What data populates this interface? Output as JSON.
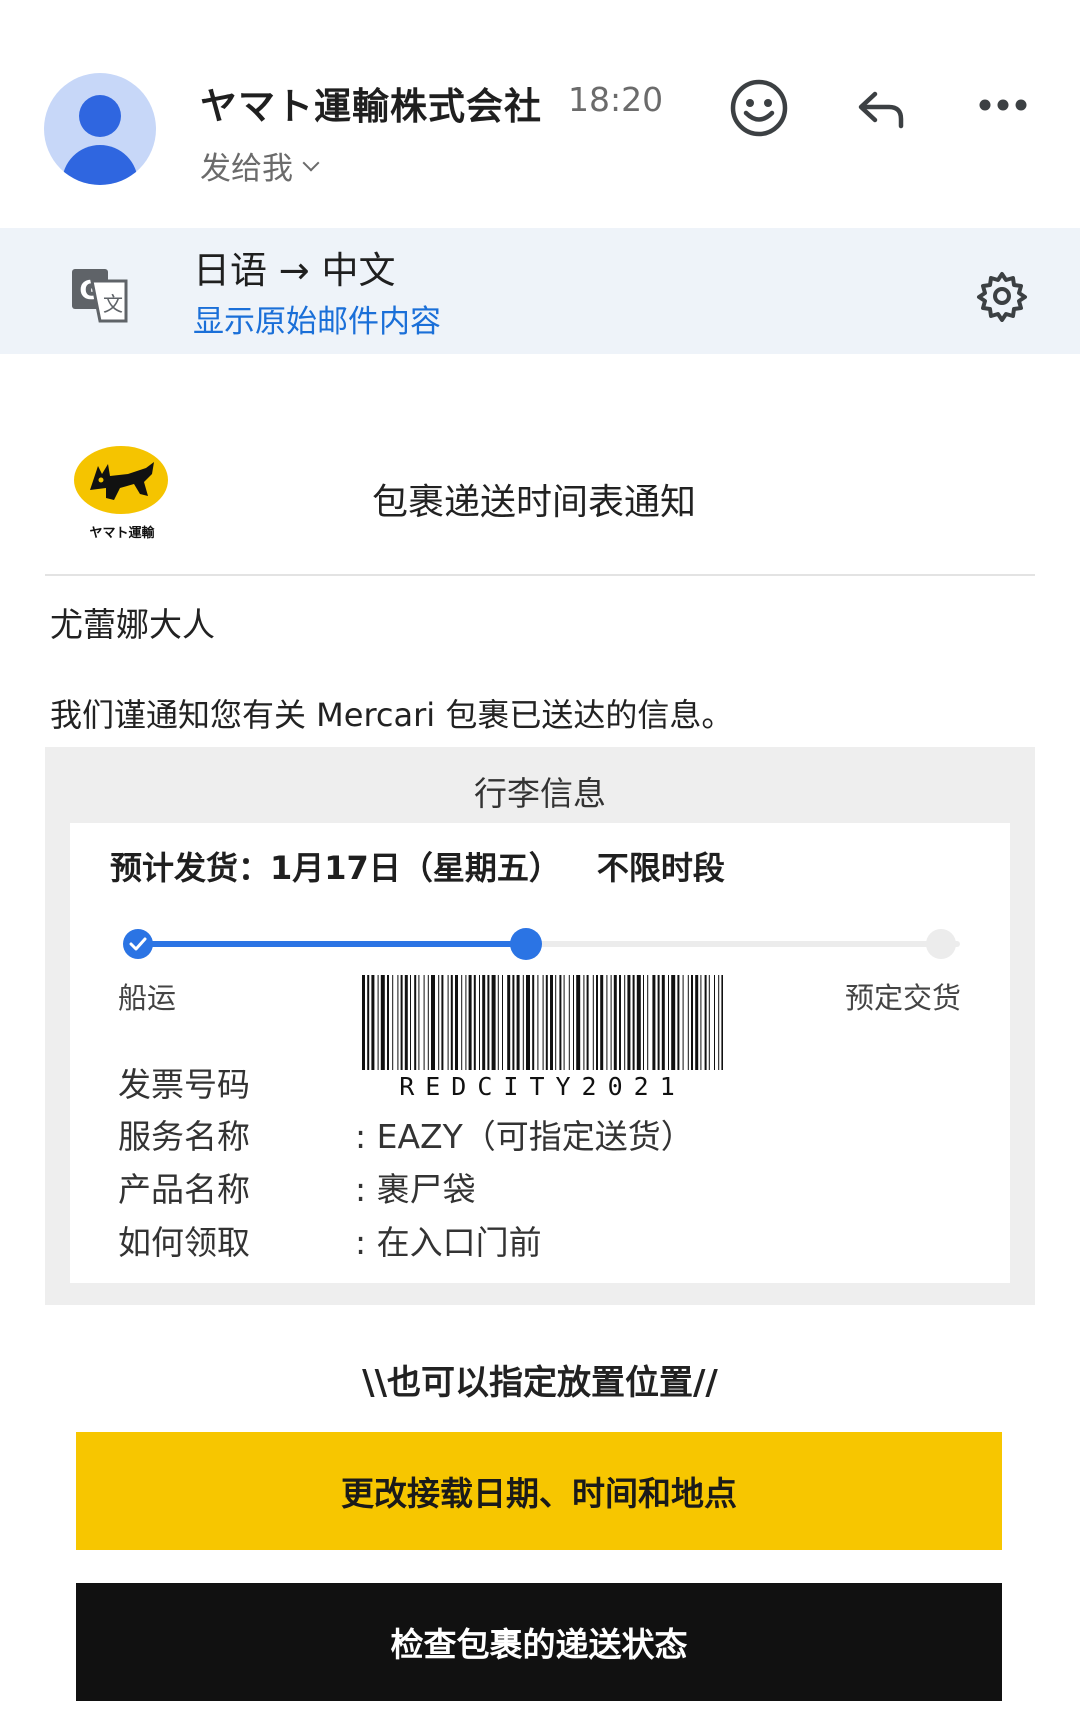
{
  "email": {
    "sender": "ヤマト運輸株式会社",
    "time": "18:20",
    "recipient_label": "发给我"
  },
  "translation": {
    "languages": "日语 → 中文",
    "show_original": "显示原始邮件内容"
  },
  "message": {
    "logo_text": "ヤマト運輸",
    "notice_title": "包裹递送时间表通知",
    "greeting": "尤蕾娜大人",
    "intro": "我们谨通知您有关 Mercari 包裹已送达的信息。",
    "package_info": {
      "title": "行李信息",
      "eta_label": "预计发货：",
      "eta_date": "1月17日（星期五）",
      "eta_slot": "不限时段",
      "progress_start_label": "船运",
      "progress_end_label": "预定交货",
      "progress_fraction": 0.48,
      "barcode_text": "REDCITY2021",
      "details": [
        {
          "label": "发票号码",
          "value": ""
        },
        {
          "label": "服务名称",
          "value": ": EAZY（可指定送货）"
        },
        {
          "label": "产品名称",
          "value": ": 裹尸袋"
        },
        {
          "label": "如何领取",
          "value": ": 在入口门前"
        }
      ]
    },
    "placement_note": "\\\\也可以指定放置位置//",
    "btn_change": "更改接载日期、时间和地点",
    "btn_status": "检查包裹的递送状态"
  },
  "colors": {
    "accent_blue": "#2b74e4",
    "link_blue": "#1a6fd8",
    "yamato_yellow": "#f7c600",
    "dark_button": "#111111"
  },
  "icons": [
    "avatar",
    "emoji-icon",
    "reply-icon",
    "more-icon",
    "translate-icon",
    "gear-icon",
    "checkmark-icon",
    "yamato-cat-logo"
  ]
}
